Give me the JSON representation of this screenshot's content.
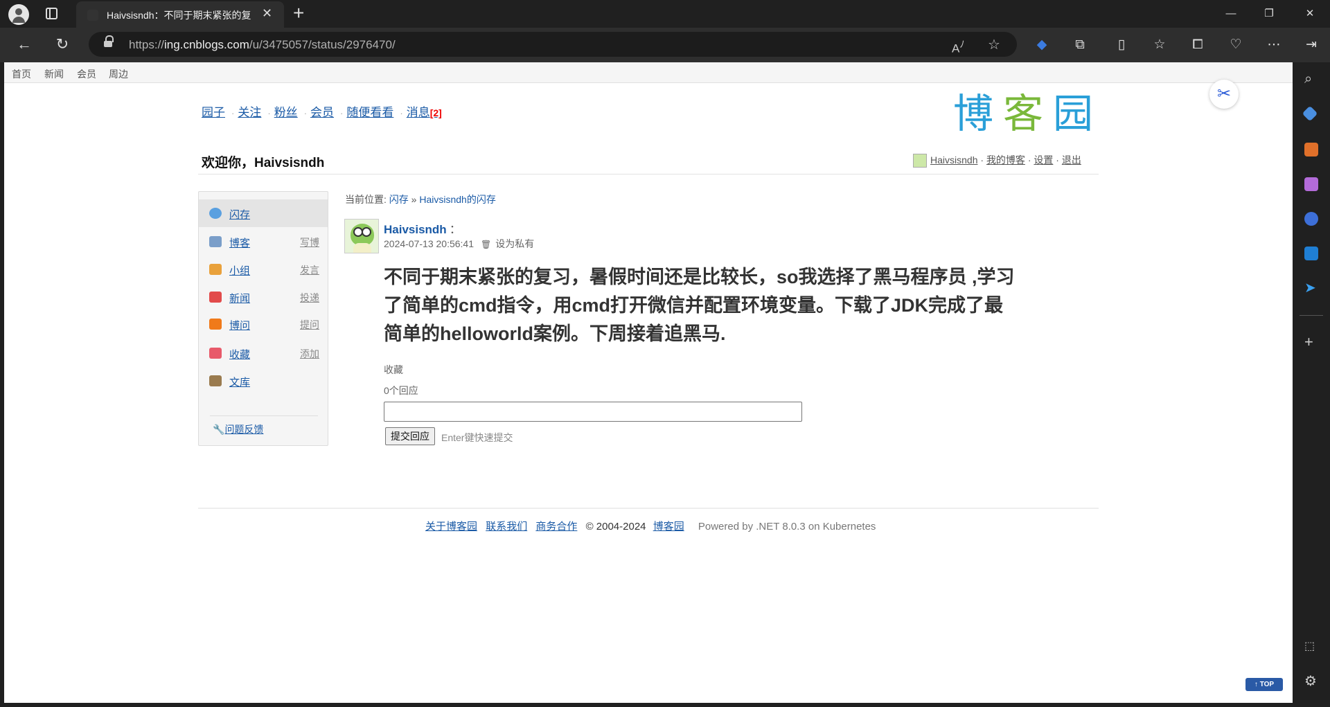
{
  "browser": {
    "tab_title": "Haivsisndh：不同于期末紧张的复",
    "url_prefix": "https://",
    "url_host": "ing.cnblogs.com",
    "url_path": "/u/3475057/status/2976470/"
  },
  "site_topnav": [
    "首页",
    "新闻",
    "会员",
    "周边"
  ],
  "main_nav": {
    "items": [
      "园子",
      "关注",
      "粉丝",
      "会员",
      "随便看看"
    ],
    "messages_label": "消息",
    "messages_count": "[2]"
  },
  "logo_chars": [
    "博",
    "客",
    "园"
  ],
  "welcome": "欢迎你，Haivsisndh",
  "userbar": {
    "username": "Haivsisndh",
    "my_blog": "我的博客",
    "settings": "设置",
    "logout": "退出",
    "sep": " · "
  },
  "sidebar": {
    "items": [
      {
        "label": "闪存",
        "action": "",
        "icon": "speech-bubble-icon",
        "color": "#5aa0e0"
      },
      {
        "label": "博客",
        "action": "写博",
        "icon": "notepad-pen-icon",
        "color": "#7a9ec9"
      },
      {
        "label": "小组",
        "action": "发言",
        "icon": "group-icon",
        "color": "#e9a13b"
      },
      {
        "label": "新闻",
        "action": "投递",
        "icon": "news-rocket-icon",
        "color": "#e24b4b"
      },
      {
        "label": "博问",
        "action": "提问",
        "icon": "question-q-icon",
        "color": "#f07a1a"
      },
      {
        "label": "收藏",
        "action": "添加",
        "icon": "bookmark-folder-icon",
        "color": "#e85a6a"
      },
      {
        "label": "文库",
        "action": "",
        "icon": "book-icon",
        "color": "#9a7b4f"
      }
    ],
    "feedback": "问题反馈"
  },
  "breadcrumb": {
    "prefix": "当前位置:",
    "level1": "闪存",
    "separator": "»",
    "level2": "Haivsisndh的闪存"
  },
  "post": {
    "author": "Haivsisndh",
    "colon": "：",
    "datetime": "2024-07-13 20:56:41",
    "set_private": "设为私有",
    "content": "不同于期末紧张的复习，暑假时间还是比较长，so我选择了黑马程序员 ,学习了简单的cmd指令，用cmd打开微信并配置环境变量。下载了JDK完成了最简单的helloworld案例。下周接着追黑马.",
    "favorite": "收藏",
    "reply_count": "0个回应",
    "reply_input_value": "",
    "submit_label": "提交回应",
    "submit_hint": "Enter键快速提交"
  },
  "footer": {
    "about": "关于博客园",
    "contact": "联系我们",
    "business": "商务合作",
    "copyright": "© 2004-2024",
    "site": "博客园",
    "powered": "Powered by .NET 8.0.3 on Kubernetes"
  },
  "back_to_top": "↑ TOP",
  "colors": {
    "link": "#1a5aa6",
    "message_badge": "#ee0000",
    "logo_blue": "#2a9fd8",
    "logo_green": "#7ab83a"
  }
}
